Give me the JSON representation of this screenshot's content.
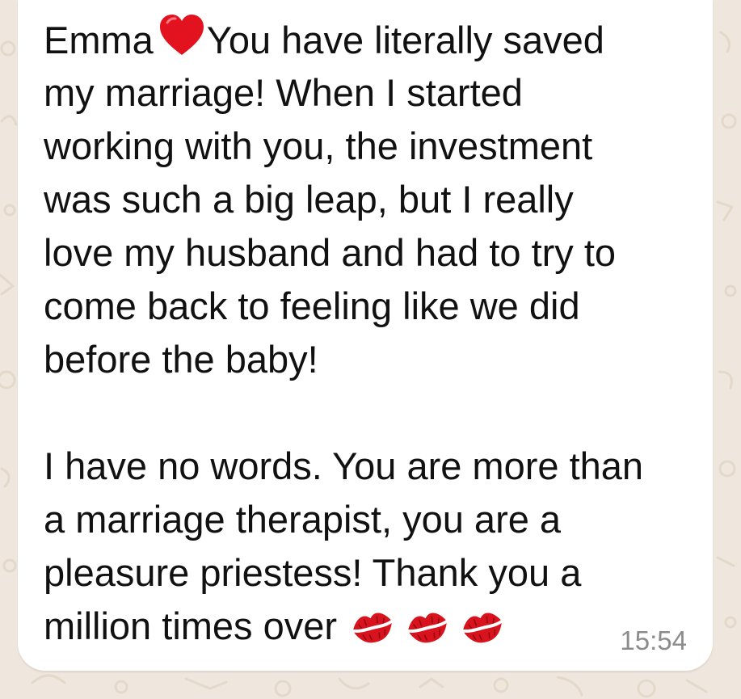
{
  "colors": {
    "wallpaper": "#efe7dd",
    "bubble": "#ffffff",
    "text": "#111111",
    "timestamp": "#8c8c8c",
    "heart": "#e2131f",
    "lips": "#d9131e"
  },
  "message": {
    "paragraph1": [
      {
        "before_icon": "Emma",
        "icon": "red-heart-icon",
        "after_icon": "You have literally saved"
      },
      {
        "text": "my marriage! When I started"
      },
      {
        "text": "working with you, the investment"
      },
      {
        "text": "was such a big leap, but I really"
      },
      {
        "text": "love my husband and had to try to"
      },
      {
        "text": "come back to feeling like we did"
      },
      {
        "text": "before the baby!"
      }
    ],
    "paragraph2": [
      {
        "text": "I have no words. You are more than"
      },
      {
        "text": "a marriage therapist, you are a"
      },
      {
        "text": "pleasure priestess! Thank you a"
      },
      {
        "text": "million times over",
        "icons": [
          "kiss-mark-icon",
          "kiss-mark-icon",
          "kiss-mark-icon"
        ]
      }
    ],
    "time": "15:54"
  }
}
